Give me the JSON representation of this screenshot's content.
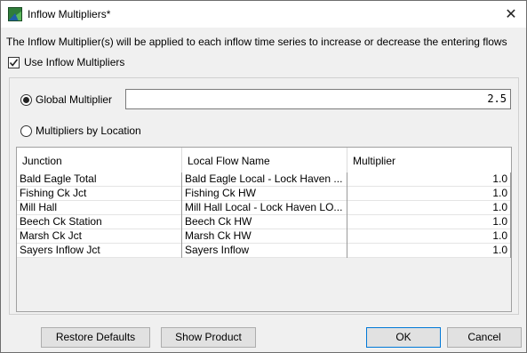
{
  "window": {
    "title": "Inflow Multipliers*"
  },
  "description": "The Inflow Multiplier(s) will be applied to each inflow time series to increase or decrease the entering flows",
  "use_multipliers": {
    "label": "Use Inflow Multipliers",
    "checked": true
  },
  "global": {
    "label": "Global Multiplier",
    "selected": true,
    "value": "2.5"
  },
  "by_location": {
    "label": "Multipliers by Location",
    "selected": false
  },
  "table": {
    "columns": [
      "Junction",
      "Local Flow Name",
      "Multiplier"
    ],
    "rows": [
      [
        "Bald Eagle Total",
        "Bald Eagle Local - Lock Haven ...",
        "1.0"
      ],
      [
        "Fishing Ck Jct",
        "Fishing Ck HW",
        "1.0"
      ],
      [
        "Mill Hall",
        "Mill Hall Local - Lock Haven LO...",
        "1.0"
      ],
      [
        "Beech Ck Station",
        "Beech Ck HW",
        "1.0"
      ],
      [
        "Marsh Ck Jct",
        "Marsh Ck HW",
        "1.0"
      ],
      [
        "Sayers Inflow Jct",
        "Sayers Inflow",
        "1.0"
      ]
    ]
  },
  "buttons": {
    "restore": "Restore Defaults",
    "show_product": "Show Product",
    "ok": "OK",
    "cancel": "Cancel"
  }
}
